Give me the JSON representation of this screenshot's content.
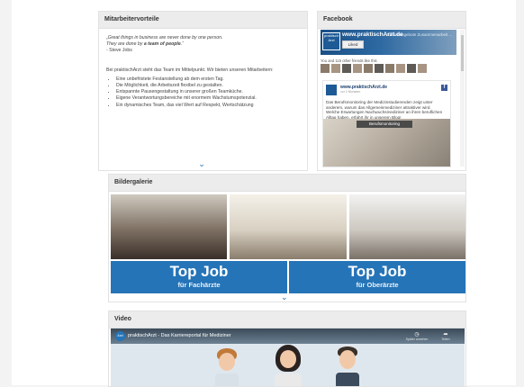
{
  "benefits": {
    "title": "Mitarbeitervorteile",
    "quote_line1": "„Great things in business are never done by one person.",
    "quote_line2_prefix": "They are done by ",
    "quote_line2_bold": "a team of people",
    "quote_line2_suffix": ".“",
    "quote_author": "- Steve Jobs",
    "intro": "Bei praktischArzt steht das Team im Mittelpunkt. Wir bieten unseren Mitarbeitern:",
    "items": [
      "Eine unbefristete Festanstellung ab dem ersten Tag.",
      "Die Möglichkeit, die Arbeitszeit flexibel zu gestalten.",
      "Entspannte Pausengestaltung in unserer großen Teamküche.",
      "Eigene Verantwortungsbereiche mit enormem Wachstumspotenzial.",
      "Ein dynamisches Team, das viel Wert auf Respekt, Wertschätzung"
    ]
  },
  "facebook": {
    "title": "Facebook",
    "page_name": "www.praktischArzt.de",
    "like_label": "Liked",
    "logo_text": "praktisch Arzt",
    "overlay_text": "...Stellenangebote Zusammenarbeit ...",
    "friends_text": "You and 115 other friends like this",
    "post_name": "www.praktischArzt.de",
    "post_meta": "vor 2 Monaten",
    "post_text": "Das Berufsmonitoring der Medizinstudierenden zeigt unter anderem, warum das Allgemeinmediziner attraktiver wird. Welche Erwartungen Nachwuchsmediziner an ihren beruflichen Alltag haben, erfahrt ihr in unserem Blog!",
    "post_tag": "Berufsmonitoring"
  },
  "gallery": {
    "title": "Bildergalerie",
    "banners": [
      {
        "big": "Top Job",
        "small": "für Fachärzte"
      },
      {
        "big": "Top Job",
        "small": "für Oberärzte"
      }
    ]
  },
  "video": {
    "title": "Video",
    "video_title": "praktischArzt - Das Karriereportal für Mediziner",
    "channel_logo": "Arzt",
    "watch_later": "Später ansehen",
    "share": "Teilen"
  },
  "colors": {
    "accent": "#2574b8",
    "panel_header": "#ececec"
  }
}
